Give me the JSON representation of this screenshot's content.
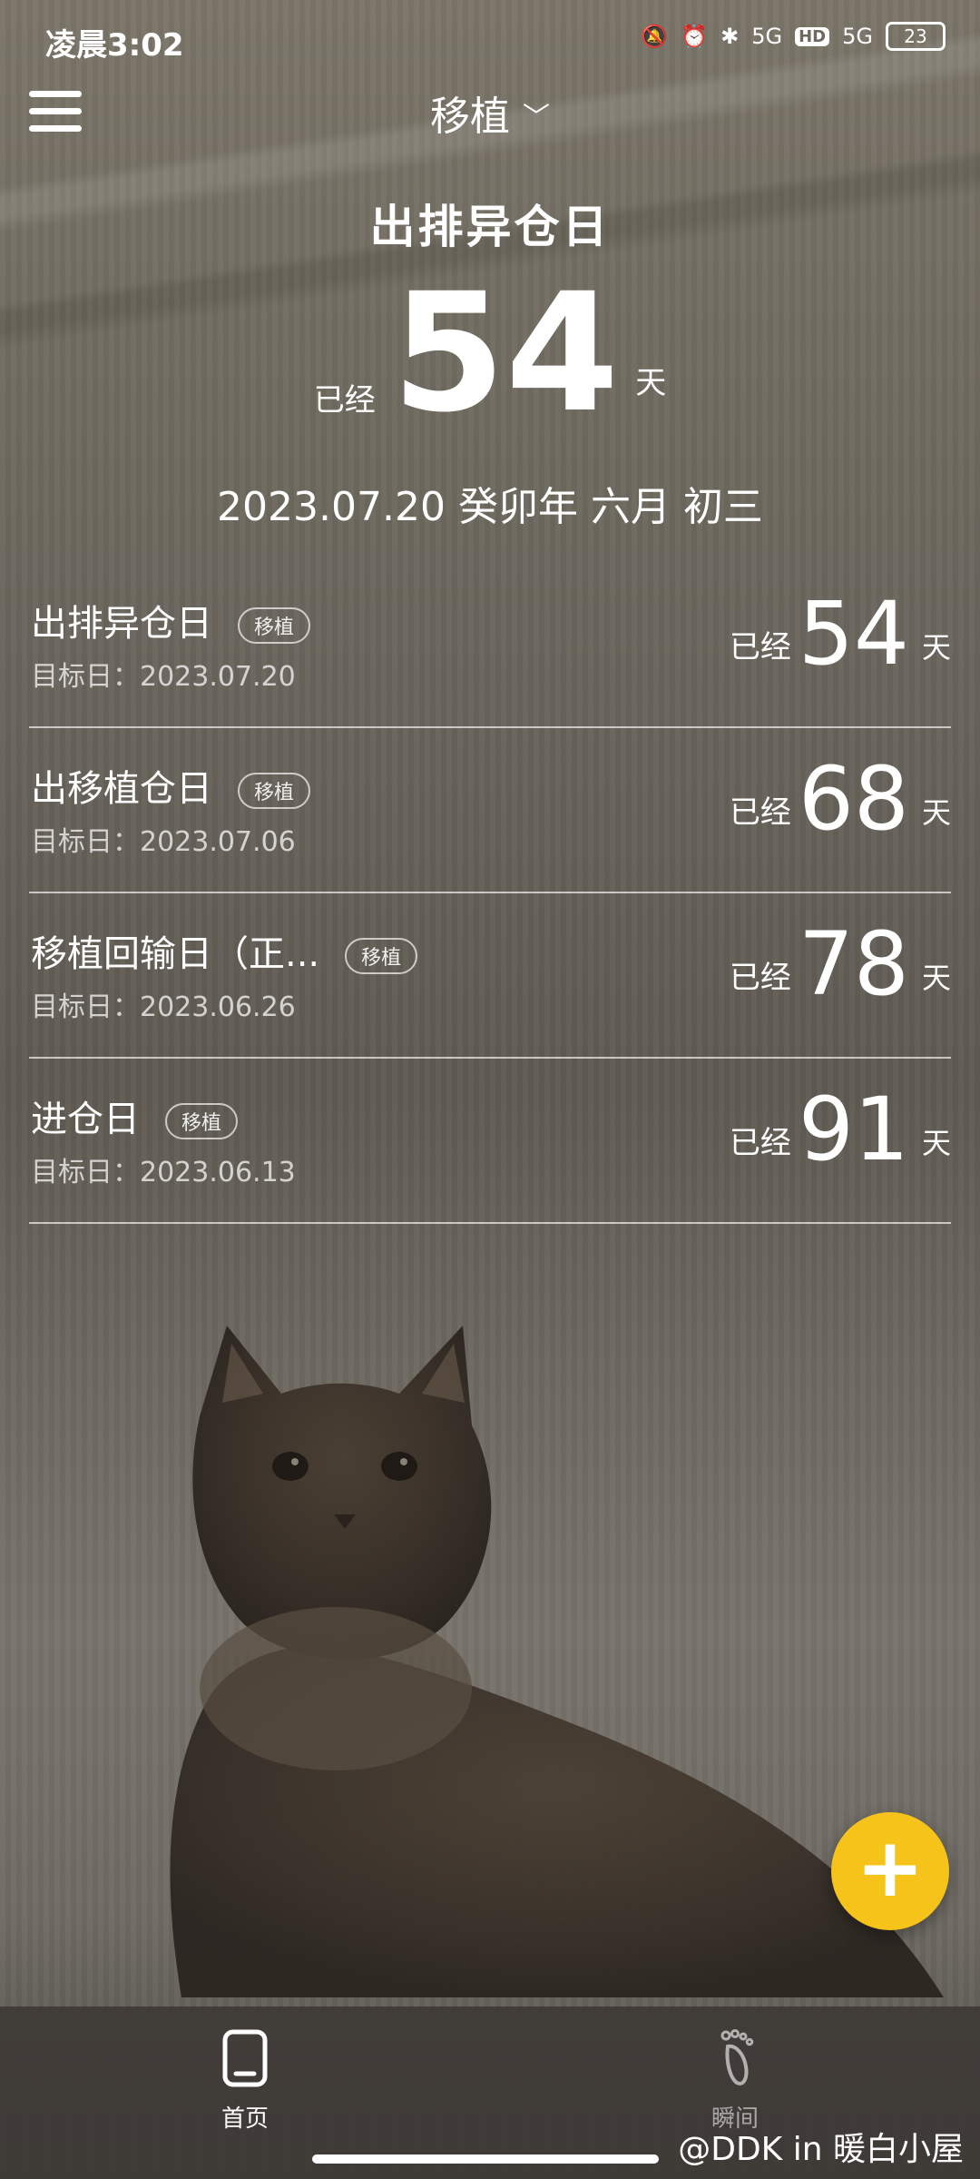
{
  "status": {
    "time": "凌晨3:02",
    "network1": "5G",
    "hd": "HD",
    "network2": "5G",
    "battery": "23"
  },
  "header": {
    "category": "移植"
  },
  "hero": {
    "title": "出排异仓日",
    "prefix": "已经",
    "count": "54",
    "suffix": "天",
    "date": "2023.07.20 癸卯年 六月 初三"
  },
  "items": [
    {
      "name": "出排异仓日",
      "tag": "移植",
      "date": "目标日：2023.07.20",
      "prefix": "已经",
      "count": "54",
      "suffix": "天"
    },
    {
      "name": "出移植仓日",
      "tag": "移植",
      "date": "目标日：2023.07.06",
      "prefix": "已经",
      "count": "68",
      "suffix": "天"
    },
    {
      "name": "移植回输日（正...",
      "tag": "移植",
      "date": "目标日：2023.06.26",
      "prefix": "已经",
      "count": "78",
      "suffix": "天"
    },
    {
      "name": "进仓日",
      "tag": "移植",
      "date": "目标日：2023.06.13",
      "prefix": "已经",
      "count": "91",
      "suffix": "天"
    }
  ],
  "fab": {
    "label": "+"
  },
  "nav": {
    "home": "首页",
    "moments": "瞬间"
  },
  "watermark": "@DDK in 暖白小屋",
  "colors": {
    "fab": "#f5c31a"
  }
}
